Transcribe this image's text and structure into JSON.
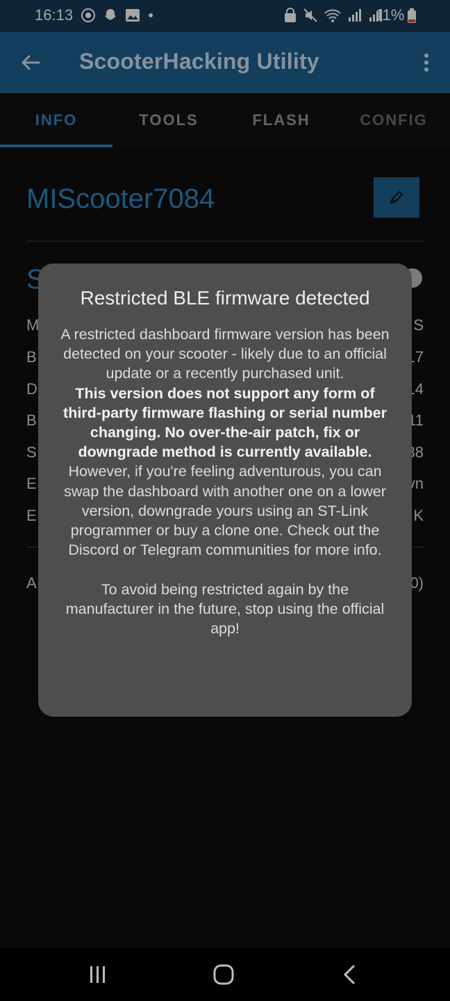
{
  "status_bar": {
    "time": "16:13",
    "battery_percent": "11%",
    "left_icons": [
      "app-notification-icon",
      "snapchat-icon",
      "gallery-icon",
      "dot-icon"
    ],
    "right_icons": [
      "lock-icon",
      "mute-icon",
      "wifi-icon",
      "signal-icon",
      "signal-icon",
      "battery-icon"
    ],
    "battery_color": "#e8452f"
  },
  "app_bar": {
    "title": "ScooterHacking Utility",
    "back_icon": "arrow-left-icon",
    "menu_icon": "more-vert-icon",
    "color": "#1e6090"
  },
  "tabs": [
    {
      "label": "INFO",
      "active": true
    },
    {
      "label": "TOOLS",
      "active": false
    },
    {
      "label": "FLASH",
      "active": false
    },
    {
      "label": "CONFIG",
      "active": false
    }
  ],
  "info": {
    "scooter_name": "MIScooter7084",
    "edit_icon": "pencil-icon",
    "section_letter": "S",
    "rows": [
      {
        "left": "M",
        "right": "S"
      },
      {
        "left": "B",
        "right": "17"
      },
      {
        "left": "D",
        "right": "14"
      },
      {
        "left": "B",
        "right": "11"
      },
      {
        "left": "S",
        "right": "38"
      },
      {
        "left": "E",
        "right": "vn"
      },
      {
        "left": "E",
        "right": "K"
      }
    ],
    "footer_row": {
      "left": "A",
      "right": "0)"
    }
  },
  "dialog": {
    "title": "Restricted BLE firmware detected",
    "body_intro": "A restricted dashboard firmware version has been detected on your scooter - likely due to an official update or a recently purchased unit.",
    "body_bold": "This version does not support any form of third-party firmware flashing or serial number changing. No over-the-air patch, fix or downgrade method is currently available.",
    "body_rest": " However, if you're feeling adventurous, you can swap the dashboard with another one on a lower version, downgrade yours using an ST-Link programmer or buy a clone one. Check out the Discord or Telegram communities for more info.",
    "body_footer": "To avoid being restricted again by the manufacturer in the future, stop using the official app!"
  },
  "nav_bar": {
    "items": [
      "recent-apps-icon",
      "home-icon",
      "back-icon"
    ]
  }
}
